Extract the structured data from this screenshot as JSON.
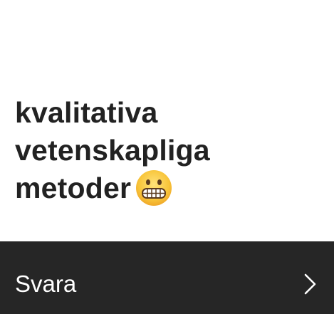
{
  "question": {
    "text": "kvalitativa vetenskapliga metoder",
    "emoji": "grimacing-face-emoji"
  },
  "answer_bar": {
    "label": "Svara",
    "icon": "chevron-right-icon"
  },
  "colors": {
    "background": "#ffffff",
    "text": "#222222",
    "bar_background": "#262626",
    "bar_text": "#ffffff",
    "emoji_fill": "#f7c43a"
  }
}
